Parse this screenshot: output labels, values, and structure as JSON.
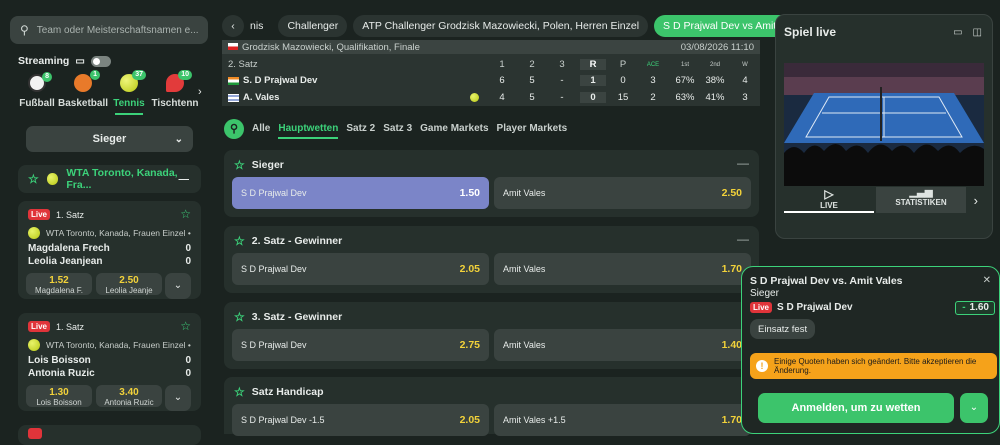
{
  "search": {
    "placeholder": "Team oder Meisterschaftsnamen e..."
  },
  "streaming": {
    "label": "Streaming"
  },
  "sports": [
    {
      "label": "Fußball",
      "count": "8",
      "color": "#ffffff"
    },
    {
      "label": "Basketball",
      "count": "1",
      "color": "#e87a2a"
    },
    {
      "label": "Tennis",
      "count": "37",
      "color": "#c8d63a",
      "active": true
    },
    {
      "label": "Tischtenn",
      "count": "10",
      "color": "#e23b3b"
    }
  ],
  "market_select": {
    "label": "Sieger"
  },
  "league": {
    "label": "WTA Toronto, Kanada, Fra..."
  },
  "matches": [
    {
      "live": "Live",
      "set": "1. Satz",
      "league": "WTA Toronto, Kanada, Frauen Einzel •",
      "p1": "Magdalena Frech",
      "s1": "0",
      "p2": "Leolia Jeanjean",
      "s2": "0",
      "o1": "1.52",
      "n1": "Magdalena F.",
      "o2": "2.50",
      "n2": "Leolia Jeanje"
    },
    {
      "live": "Live",
      "set": "1. Satz",
      "league": "WTA Toronto, Kanada, Frauen Einzel •",
      "p1": "Lois Boisson",
      "s1": "0",
      "p2": "Antonia Ruzic",
      "s2": "0",
      "o1": "1.30",
      "n1": "Lois Boisson",
      "o2": "3.40",
      "n2": "Antonia Ruzic"
    }
  ],
  "breadcrumbs": {
    "partial": "nis",
    "b1": "Challenger",
    "b2": "ATP Challenger Grodzisk Mazowiecki, Polen, Herren Einzel",
    "event": "S D Prajwal Dev  vs  Amit Vales"
  },
  "scoreboard": {
    "event_info": "Grodzisk Mazowiecki, Qualifikation, Finale",
    "datetime": "03/08/2026 11:10",
    "period": "2. Satz",
    "headers": [
      "1",
      "2",
      "3",
      "R",
      "P",
      "ACE",
      "1st",
      "2nd",
      "W"
    ],
    "p1": {
      "name": "S. D Prajwal Dev",
      "vals": [
        "6",
        "5",
        "-",
        "1",
        "0",
        "3",
        "67%",
        "38%",
        "4"
      ]
    },
    "p2": {
      "name": "A. Vales",
      "vals": [
        "4",
        "5",
        "-",
        "0",
        "15",
        "2",
        "63%",
        "41%",
        "3"
      ]
    }
  },
  "tabs": [
    "Alle",
    "Hauptwetten",
    "Satz 2",
    "Satz 3",
    "Game Markets",
    "Player Markets"
  ],
  "markets": [
    {
      "title": "Sieger",
      "a": "S D Prajwal Dev",
      "ao": "1.50",
      "b": "Amit Vales",
      "bo": "2.50"
    },
    {
      "title": "2. Satz - Gewinner",
      "a": "S D Prajwal Dev",
      "ao": "2.05",
      "b": "Amit Vales",
      "bo": "1.70"
    },
    {
      "title": "3. Satz - Gewinner",
      "a": "S D Prajwal Dev",
      "ao": "2.75",
      "b": "Amit Vales",
      "bo": "1.40"
    },
    {
      "title": "Satz Handicap",
      "a": "S D Prajwal Dev -1.5",
      "ao": "2.05",
      "b": "Amit Vales +1.5",
      "bo": "1.70"
    }
  ],
  "live_panel": {
    "title": "Spiel live",
    "tab_live": "LIVE",
    "tab_stats": "STATISTIKEN"
  },
  "betslip": {
    "match": "S D Prajwal Dev vs. Amit Vales",
    "market": "Sieger",
    "live": "Live",
    "selection": "S D Prajwal Dev",
    "odds": "1.60",
    "stake_fix": "Einsatz fest",
    "warning": "Einige Quoten haben sich geändert. Bitte akzeptieren die Änderung.",
    "login": "Anmelden, um zu wetten"
  }
}
